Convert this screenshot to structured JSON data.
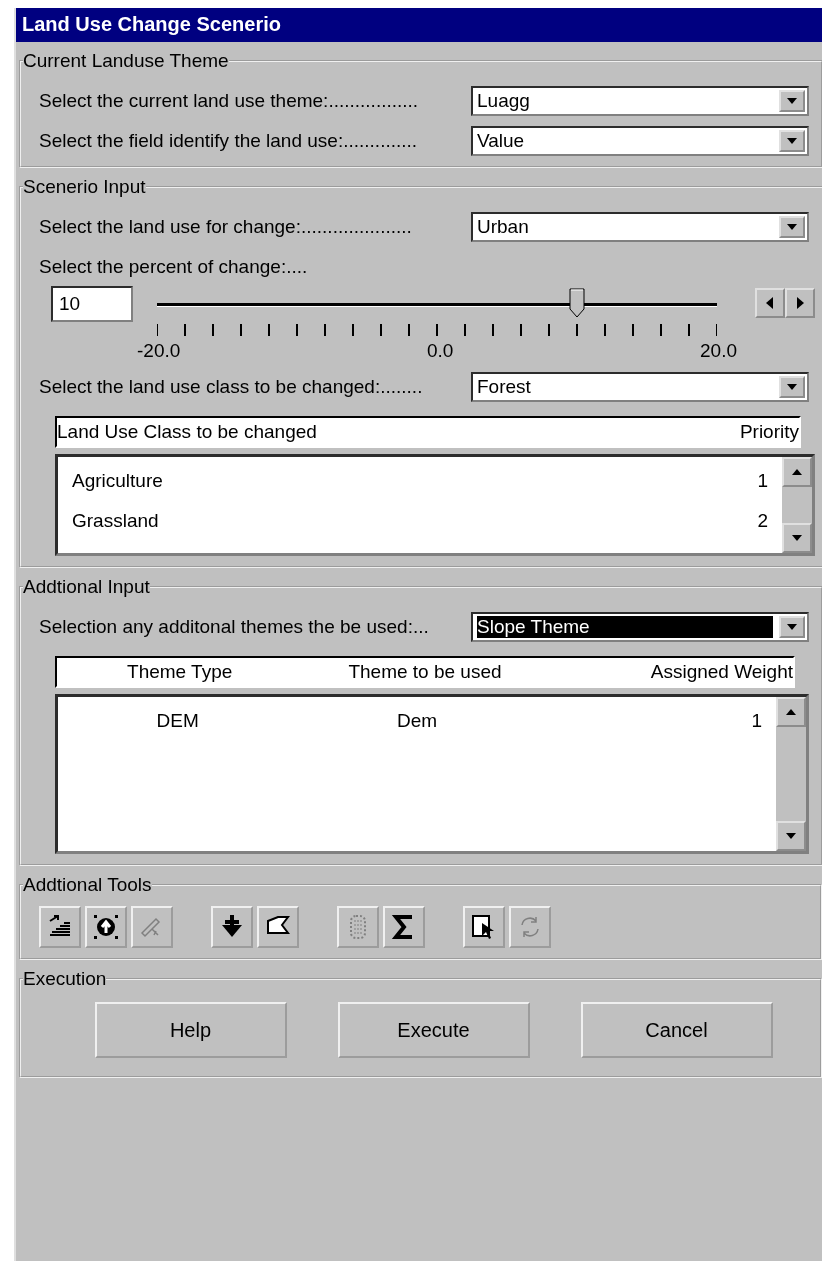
{
  "window": {
    "title": "Land Use Change Scenerio"
  },
  "current_theme": {
    "legend": "Current Landuse Theme",
    "rows": [
      {
        "label": "Select the current land use theme:.................",
        "value": "Luagg",
        "highlighted": false
      },
      {
        "label": "Select the field identify the land use:..............",
        "value": "Value",
        "highlighted": false
      }
    ]
  },
  "scenario": {
    "legend": "Scenerio Input",
    "rows": [
      {
        "label": "Select the land use for change:.....................",
        "value": "Urban",
        "highlighted": false
      }
    ],
    "percent_label": "Select the percent of change:....",
    "percent_value": "10",
    "slider": {
      "level": 0.75,
      "tick_labels": [
        "-20.0",
        "0.0",
        "20.0"
      ]
    },
    "class_row": {
      "label": "Select the land use class to be changed:........",
      "value": "Forest",
      "highlighted": false
    },
    "table": {
      "columns": [
        "Land Use Class to be changed",
        "Priority"
      ],
      "rows": [
        {
          "cells": [
            "Agriculture",
            "1"
          ],
          "selected": false
        },
        {
          "cells": [
            "Grassland",
            "2"
          ],
          "selected": false
        }
      ]
    }
  },
  "additional_input": {
    "legend": "Addtional Input",
    "rows": [
      {
        "label": "Selection any additonal themes the be used:...",
        "value": "Slope Theme",
        "highlighted": true
      }
    ],
    "table": {
      "columns": [
        "Theme Type",
        "Theme to be used",
        "Assigned Weight"
      ],
      "rows": [
        {
          "cells": [
            "DEM",
            "Dem",
            "1"
          ],
          "selected": false
        }
      ]
    }
  },
  "tools": {
    "legend": "Addtional Tools",
    "groups": [
      [
        {
          "kind": "stairs",
          "disabled": false
        },
        {
          "kind": "target",
          "disabled": false
        },
        {
          "kind": "pencil",
          "disabled": true
        }
      ],
      [
        {
          "kind": "plus",
          "disabled": false
        },
        {
          "kind": "flag",
          "disabled": false
        }
      ],
      [
        {
          "kind": "dots",
          "disabled": true
        },
        {
          "kind": "sigma",
          "disabled": false
        }
      ],
      [
        {
          "kind": "pointer",
          "disabled": false
        },
        {
          "kind": "refresh",
          "disabled": true
        }
      ]
    ]
  },
  "execution": {
    "legend": "Execution",
    "buttons": [
      "Help",
      "Execute",
      "Cancel"
    ]
  }
}
